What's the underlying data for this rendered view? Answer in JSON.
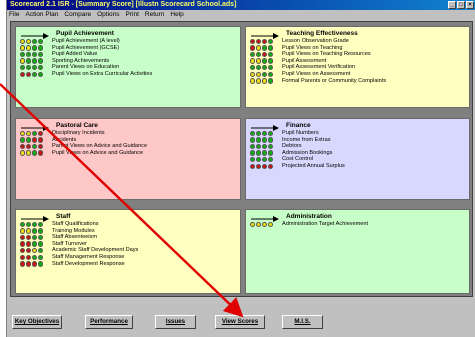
{
  "window": {
    "title": "Scorecard 2.1 ISR - [Summary Score] [Illustn Scorecard School.ads]",
    "controls": [
      "_",
      "□",
      "×"
    ]
  },
  "menu": [
    "File",
    "Action Plan",
    "Compare",
    "Options",
    "Print",
    "Return",
    "Help"
  ],
  "colors": {
    "green_panel": "#c8ffc8",
    "yellow_panel": "#ffffc0",
    "red_panel": "#ffc8c8",
    "blue_panel": "#d8d8ff",
    "dot_green": "#10b010",
    "dot_yellow": "#f0e010",
    "dot_red": "#d01010",
    "annotation_arrow": "#e00000"
  },
  "panels": [
    {
      "title": "Pupil Achievement",
      "color": "green",
      "items": [
        {
          "label": "Pupil Achievement (A level)",
          "dots": [
            "y",
            "y",
            "g",
            "g"
          ]
        },
        {
          "label": "Pupil Achievement (GCSE)",
          "dots": [
            "y",
            "y",
            "g",
            "g"
          ]
        },
        {
          "label": "Pupil Added Value",
          "dots": [
            "g",
            "g",
            "g",
            "g"
          ]
        },
        {
          "label": "Sporting Achievements",
          "dots": [
            "y",
            "g",
            "g",
            "g"
          ]
        },
        {
          "label": "Parent Views on Education",
          "dots": [
            "g",
            "g",
            "g",
            "g"
          ]
        },
        {
          "label": "Pupil Views on Extra Curricular Activities",
          "dots": [
            "r",
            "r",
            "g",
            "g"
          ]
        }
      ]
    },
    {
      "title": "Teaching Effectiveness",
      "color": "yellow",
      "items": [
        {
          "label": "Lesson Observation Grade",
          "dots": [
            "r",
            "r",
            "r",
            "g"
          ]
        },
        {
          "label": "Pupil Views on Teaching",
          "dots": [
            "r",
            "y",
            "g",
            "g"
          ]
        },
        {
          "label": "Pupil Views on Teaching Resources",
          "dots": [
            "g",
            "g",
            "r",
            "g"
          ]
        },
        {
          "label": "Pupil Assessment",
          "dots": [
            "y",
            "y",
            "g",
            "g"
          ]
        },
        {
          "label": "Pupil Assessment Verification",
          "dots": [
            "g",
            "g",
            "g",
            "g"
          ]
        },
        {
          "label": "Pupil Views on Assessment",
          "dots": [
            "y",
            "y",
            "g",
            "g"
          ]
        },
        {
          "label": "Formal Parents or Community Complaints",
          "dots": [
            "y",
            "y",
            "y",
            "g"
          ]
        }
      ]
    },
    {
      "title": "Pastoral Care",
      "color": "red",
      "items": [
        {
          "label": "Disciplinary Incidents",
          "dots": [
            "y",
            "y",
            "g",
            "r"
          ]
        },
        {
          "label": "Accidents",
          "dots": [
            "g",
            "g",
            "r",
            "r"
          ]
        },
        {
          "label": "Parent Views on Advice and Guidance",
          "dots": [
            "r",
            "r",
            "g",
            "r"
          ]
        },
        {
          "label": "Pupil Views on Advice and Guidance",
          "dots": [
            "y",
            "y",
            "g",
            "r"
          ]
        }
      ]
    },
    {
      "title": "Finance",
      "color": "blue",
      "items": [
        {
          "label": "Pupil Numbers",
          "dots": [
            "g",
            "g",
            "g",
            "g"
          ]
        },
        {
          "label": "Income from Extras",
          "dots": [
            "g",
            "g",
            "g",
            "g"
          ]
        },
        {
          "label": "Debtors",
          "dots": [
            "g",
            "g",
            "g",
            "g"
          ]
        },
        {
          "label": "Admission Bookings",
          "dots": [
            "g",
            "g",
            "g",
            "g"
          ]
        },
        {
          "label": "Cost Control",
          "dots": [
            "g",
            "g",
            "g",
            "g"
          ]
        },
        {
          "label": "Projected Annual Surplus",
          "dots": [
            "r",
            "r",
            "r",
            "r"
          ]
        }
      ]
    },
    {
      "title": "Staff",
      "color": "yellow",
      "items": [
        {
          "label": "Staff Qualifications",
          "dots": [
            "g",
            "g",
            "g",
            "g"
          ]
        },
        {
          "label": "Training Modules",
          "dots": [
            "y",
            "y",
            "g",
            "g"
          ]
        },
        {
          "label": "Staff Absenteeism",
          "dots": [
            "r",
            "r",
            "g",
            "g"
          ]
        },
        {
          "label": "Staff Turnover",
          "dots": [
            "r",
            "r",
            "g",
            "g"
          ]
        },
        {
          "label": "Academic Staff Development Days",
          "dots": [
            "r",
            "r",
            "y",
            "g"
          ]
        },
        {
          "label": "Staff Management Response",
          "dots": [
            "r",
            "r",
            "g",
            "g"
          ]
        },
        {
          "label": "Staff Development Response",
          "dots": [
            "r",
            "r",
            "r",
            "g"
          ]
        }
      ]
    },
    {
      "title": "Administration",
      "color": "green",
      "items": [
        {
          "label": "Administration Target Achievement",
          "dots": [
            "y",
            "y",
            "y",
            "y"
          ]
        }
      ]
    }
  ],
  "buttons": [
    "Key Objectives",
    "Performance",
    "Issues",
    "View Scores",
    "M.I.S."
  ]
}
